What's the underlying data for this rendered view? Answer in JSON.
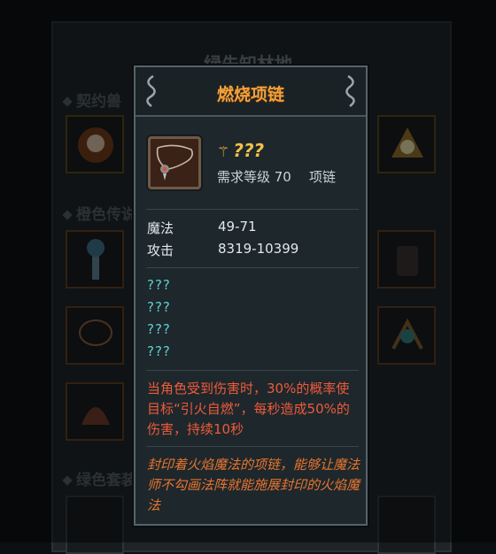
{
  "background": {
    "title": "绿先知林地",
    "sections": [
      "契约兽",
      "橙色传说",
      "绿色套装"
    ]
  },
  "tooltip": {
    "item_name": "燃烧项链",
    "item_icon": "necklace-icon",
    "quality_text": "???",
    "level_requirement": "需求等级 70",
    "item_type": "项链",
    "stats": [
      {
        "name": "魔法",
        "value": "49-71"
      },
      {
        "name": "攻击",
        "value": "8319-10399"
      }
    ],
    "unknown_lines": [
      "???",
      "???",
      "???",
      "???"
    ],
    "effect_text": "当角色受到伤害时，30%的概率使目标“引火自燃”，每秒造成50%的伤害，持续10秒",
    "lore_text": "封印着火焰魔法的项链，能够让魔法师不勾画法阵就能施展封印的火焰魔法"
  },
  "colors": {
    "title": "#f2a13a",
    "quality": "#f0c24a",
    "unknown": "#5fd0cf",
    "effect": "#f05a3a",
    "lore": "#e9742e"
  }
}
